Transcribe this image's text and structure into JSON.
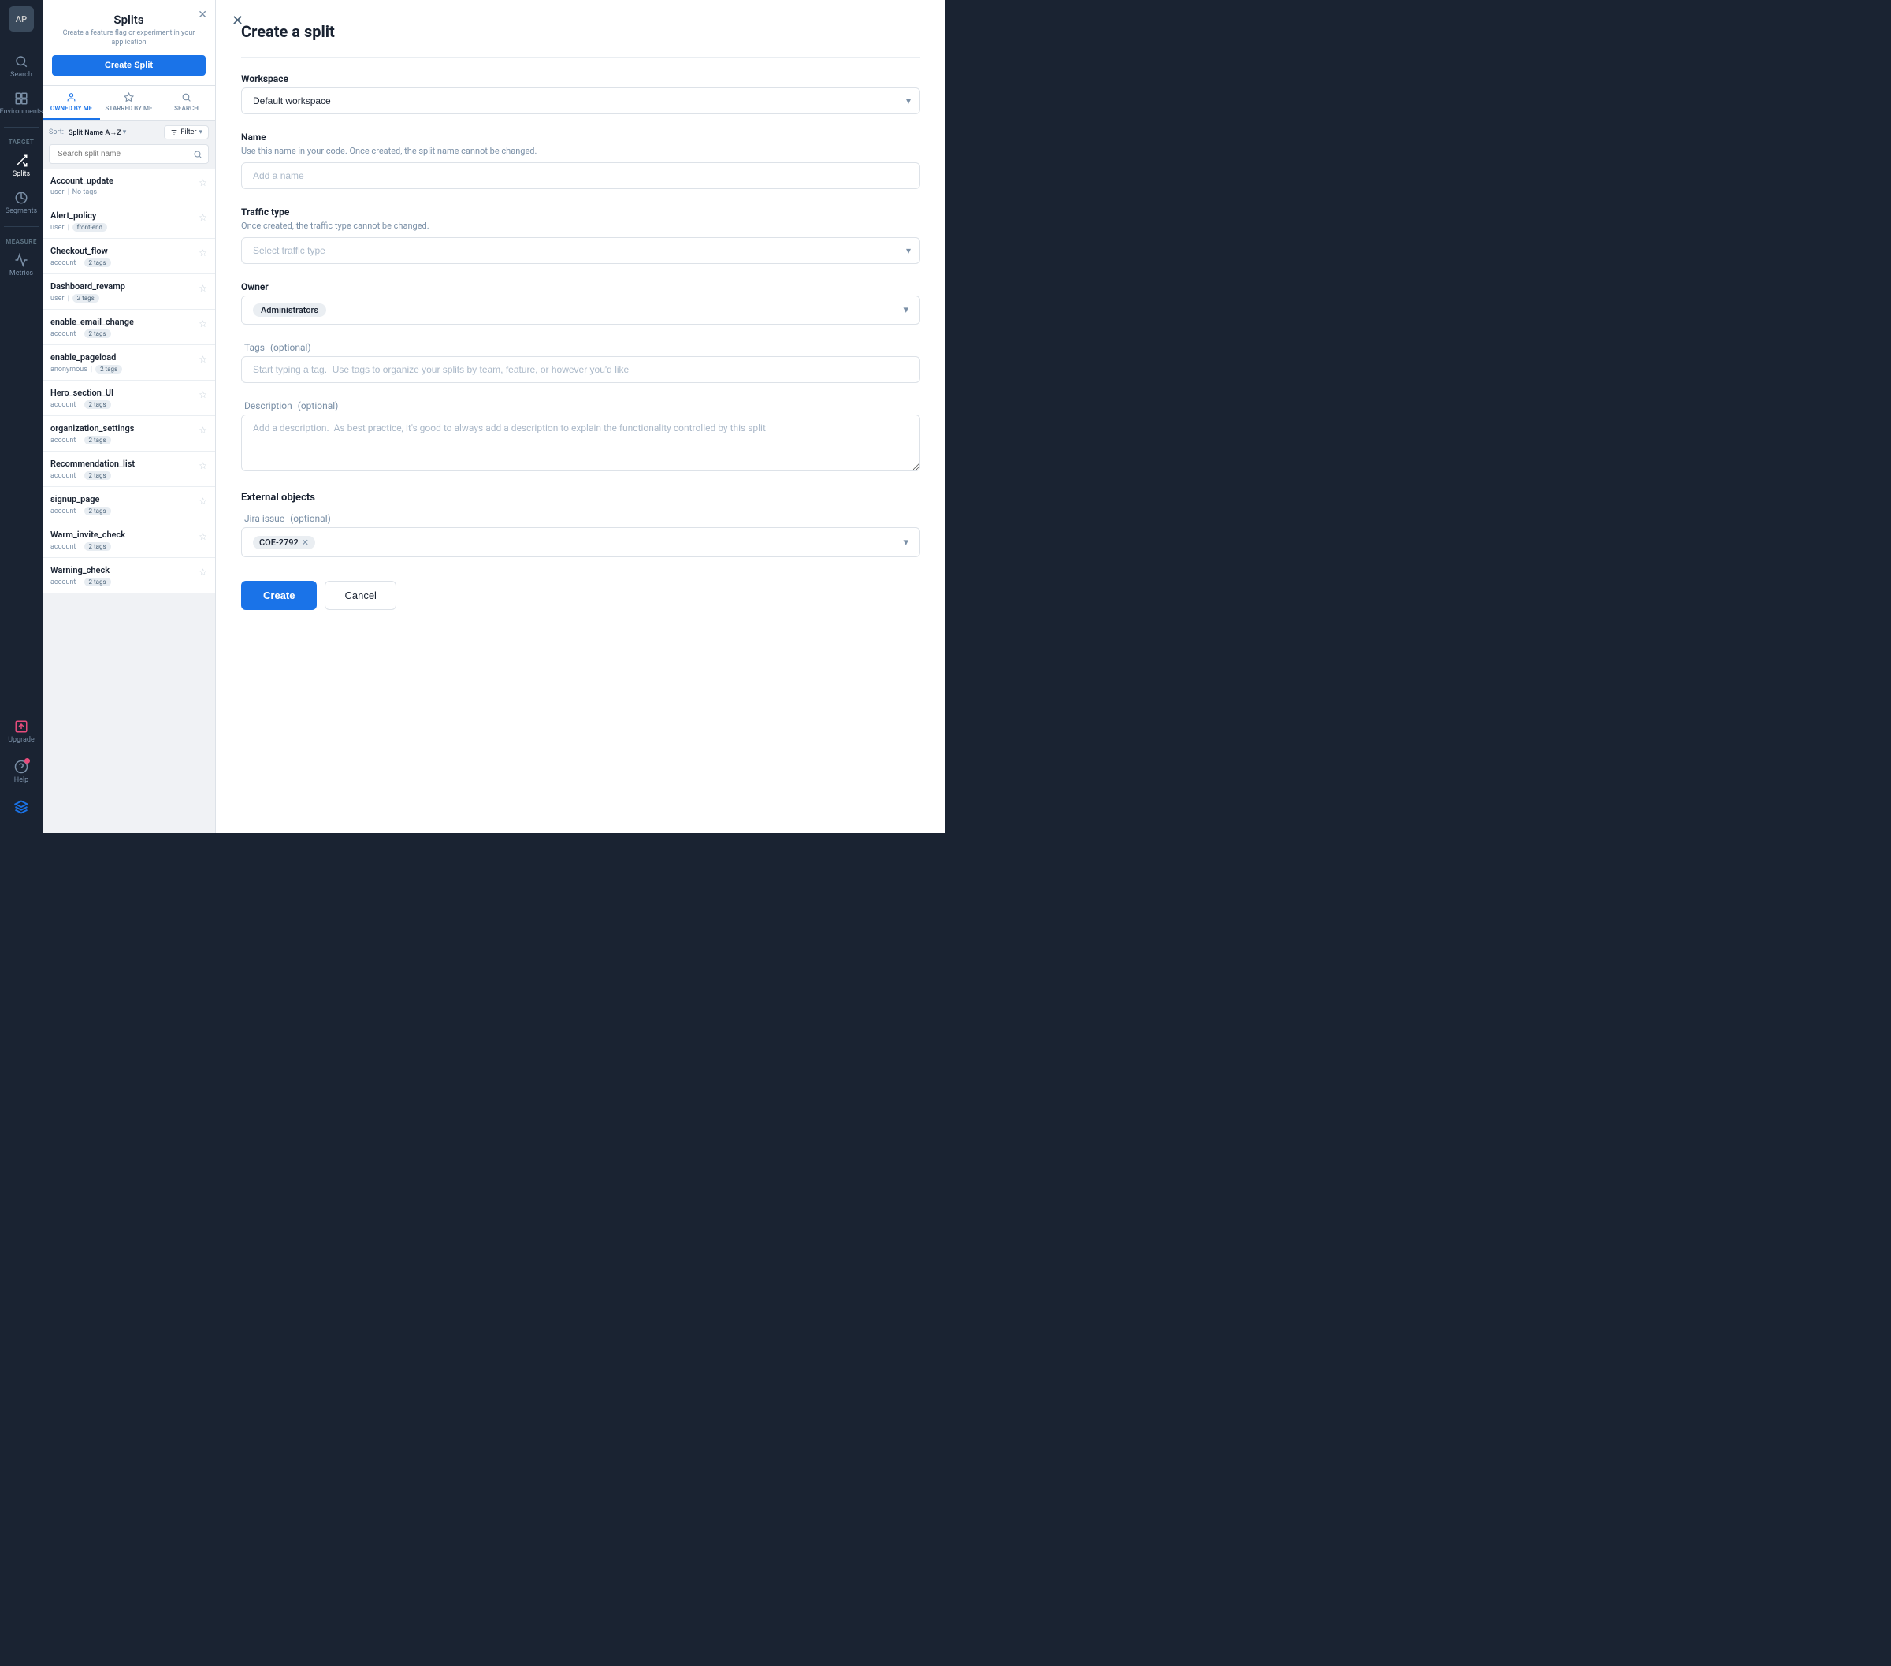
{
  "sidebar": {
    "avatar": "AP",
    "items": [
      {
        "id": "search",
        "label": "Search",
        "icon": "search"
      },
      {
        "id": "environments",
        "label": "Environments",
        "icon": "environments"
      }
    ],
    "sections": [
      {
        "label": "TARGET",
        "items": [
          {
            "id": "splits",
            "label": "Splits",
            "icon": "splits",
            "active": true
          },
          {
            "id": "segments",
            "label": "Segments",
            "icon": "segments"
          }
        ]
      },
      {
        "label": "MEASURE",
        "items": [
          {
            "id": "metrics",
            "label": "Metrics",
            "icon": "metrics"
          }
        ]
      }
    ],
    "bottom": [
      {
        "id": "upgrade",
        "label": "Upgrade",
        "icon": "upgrade"
      },
      {
        "id": "help",
        "label": "Help",
        "icon": "help",
        "notification": true
      },
      {
        "id": "brand",
        "label": "",
        "icon": "brand"
      }
    ]
  },
  "splits_panel": {
    "title": "Splits",
    "subtitle": "Create a feature flag or experiment in your application",
    "create_button": "Create Split",
    "tabs": [
      {
        "id": "owned",
        "label": "OWNED BY ME",
        "active": true
      },
      {
        "id": "starred",
        "label": "STARRED BY ME"
      },
      {
        "id": "search",
        "label": "SEARCH"
      }
    ],
    "sort_label": "Sort:",
    "sort_value": "Split Name A→Z",
    "filter_label": "Filter",
    "search_placeholder": "Search split name",
    "splits": [
      {
        "name": "Account_update",
        "type": "user",
        "tags": "No tags",
        "tags_type": "plain"
      },
      {
        "name": "Alert_policy",
        "type": "user",
        "tags": "front-end",
        "tags_type": "badge"
      },
      {
        "name": "Checkout_flow",
        "type": "account",
        "tags": "2 tags",
        "tags_type": "badge"
      },
      {
        "name": "Dashboard_revamp",
        "type": "user",
        "tags": "2 tags",
        "tags_type": "badge"
      },
      {
        "name": "enable_email_change",
        "type": "account",
        "tags": "2 tags",
        "tags_type": "badge"
      },
      {
        "name": "enable_pageload",
        "type": "anonymous",
        "tags": "2 tags",
        "tags_type": "badge"
      },
      {
        "name": "Hero_section_UI",
        "type": "account",
        "tags": "2 tags",
        "tags_type": "badge"
      },
      {
        "name": "organization_settings",
        "type": "account",
        "tags": "2 tags",
        "tags_type": "badge"
      },
      {
        "name": "Recommendation_list",
        "type": "account",
        "tags": "2 tags",
        "tags_type": "badge"
      },
      {
        "name": "signup_page",
        "type": "account",
        "tags": "2 tags",
        "tags_type": "badge"
      },
      {
        "name": "Warm_invite_check",
        "type": "account",
        "tags": "2 tags",
        "tags_type": "badge"
      },
      {
        "name": "Warning_check",
        "type": "account",
        "tags": "2 tags",
        "tags_type": "badge"
      }
    ]
  },
  "create_split": {
    "title": "Create a split",
    "workspace_label": "Workspace",
    "workspace_value": "Default workspace",
    "name_label": "Name",
    "name_hint": "Use this name in your code. Once created, the split name cannot be changed.",
    "name_placeholder": "Add a name",
    "traffic_type_label": "Traffic type",
    "traffic_type_hint": "Once created, the traffic type cannot be changed.",
    "traffic_type_placeholder": "Select traffic type",
    "owner_label": "Owner",
    "owner_value": "Administrators",
    "tags_label": "Tags",
    "tags_optional": "(optional)",
    "tags_placeholder": "Start typing a tag.  Use tags to organize your splits by team, feature, or however you'd like",
    "description_label": "Description",
    "description_optional": "(optional)",
    "description_placeholder": "Add a description.  As best practice, it's good to always add a description to explain the functionality controlled by this split",
    "external_objects_label": "External objects",
    "jira_label": "Jira issue",
    "jira_optional": "(optional)",
    "jira_tag": "COE-2792",
    "create_button": "Create",
    "cancel_button": "Cancel"
  }
}
